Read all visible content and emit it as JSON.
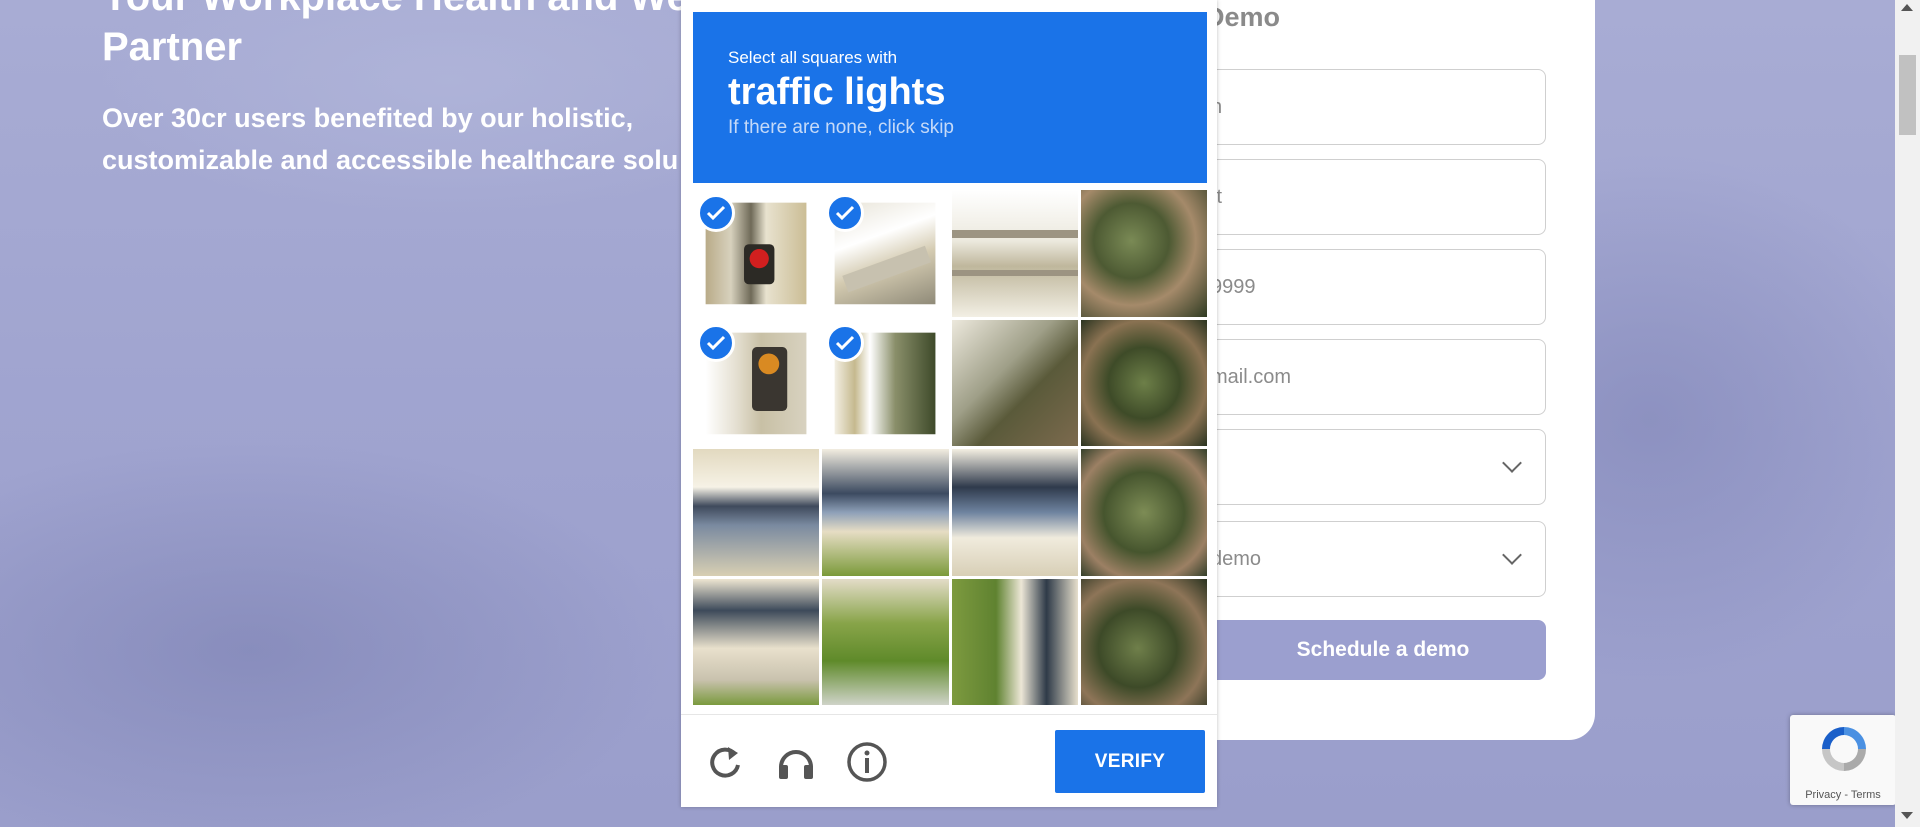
{
  "hero": {
    "title_line1": "Your Workplace Health and We",
    "title_line2": "Partner",
    "subtitle": "Over 30cr users benefited by our holistic, customizable and accessible healthcare solu"
  },
  "form": {
    "heading": "e a Demo",
    "fields": [
      {
        "value": "n"
      },
      {
        "value": "ıt"
      },
      {
        "value": "9999"
      },
      {
        "value": "mail.com"
      },
      {
        "value": ")",
        "dropdown": true
      },
      {
        "value": "demo",
        "dropdown": true
      }
    ],
    "submit_label": "Schedule a demo"
  },
  "captcha": {
    "instruction": "Select all squares with",
    "target": "traffic lights",
    "hint": "If there are none, click skip",
    "tiles_selected": [
      1,
      2,
      5,
      6
    ],
    "verify_label": "VERIFY",
    "icons": [
      "reload-icon",
      "audio-icon",
      "info-icon"
    ]
  },
  "recaptcha_badge": {
    "links": "Privacy - Terms"
  },
  "colors": {
    "accent": "#1a73e8",
    "background": "#a3a8d0",
    "schedule_button": "#9b9fcf"
  }
}
